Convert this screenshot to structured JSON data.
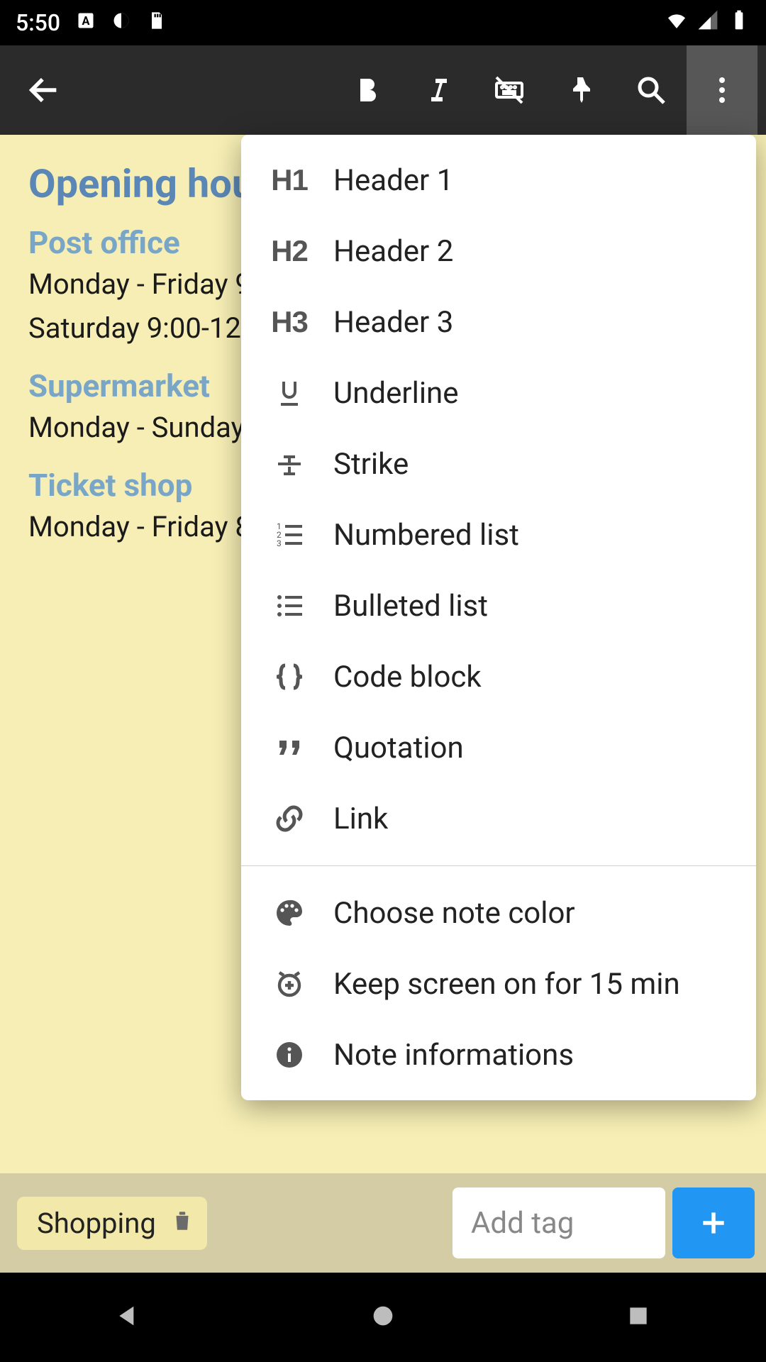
{
  "status": {
    "time": "5:50"
  },
  "note": {
    "title": "Opening hou",
    "sections": [
      {
        "heading": "Post office",
        "lines": [
          "Monday - Friday 9",
          "Saturday 9:00-12:"
        ]
      },
      {
        "heading": "Supermarket",
        "lines": [
          "Monday - Sunday"
        ]
      },
      {
        "heading": "Ticket shop",
        "lines": [
          "Monday - Friday 8"
        ]
      }
    ]
  },
  "menu": {
    "group1": [
      {
        "label": "Header 1"
      },
      {
        "label": "Header 2"
      },
      {
        "label": "Header 3"
      },
      {
        "label": "Underline"
      },
      {
        "label": "Strike"
      },
      {
        "label": "Numbered list"
      },
      {
        "label": "Bulleted list"
      },
      {
        "label": "Code block"
      },
      {
        "label": "Quotation"
      },
      {
        "label": "Link"
      }
    ],
    "group2": [
      {
        "label": "Choose note color"
      },
      {
        "label": "Keep screen on for 15 min"
      },
      {
        "label": "Note informations"
      }
    ]
  },
  "tags": {
    "chip": "Shopping",
    "placeholder": "Add tag"
  }
}
